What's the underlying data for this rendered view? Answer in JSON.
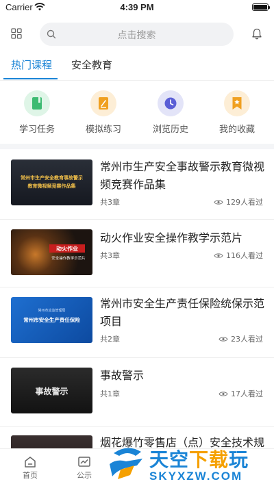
{
  "status_bar": {
    "carrier": "Carrier",
    "time": "4:39 PM"
  },
  "header": {
    "search_placeholder": "点击搜索"
  },
  "tabs": [
    {
      "label": "热门课程",
      "active": true
    },
    {
      "label": "安全教育",
      "active": false
    }
  ],
  "quick_actions": [
    {
      "label": "学习任务",
      "icon": "book-icon",
      "color": "#3dbb72",
      "bg": "#dff5e7"
    },
    {
      "label": "模拟练习",
      "icon": "exercise-icon",
      "color": "#f0a020",
      "bg": "#fdeed6"
    },
    {
      "label": "浏览历史",
      "icon": "clock-icon",
      "color": "#5b5fd6",
      "bg": "#e3e4f8"
    },
    {
      "label": "我的收藏",
      "icon": "bookmark-icon",
      "color": "#f0a020",
      "bg": "#fdeed6"
    }
  ],
  "courses": [
    {
      "title": "常州市生产安全事故警示教育微视频竞赛作品集",
      "chapters": "共3章",
      "views": "129人看过",
      "thumb_lines": [
        "常州市生产安全教育事故警示",
        "教育微视频竞赛作品集"
      ]
    },
    {
      "title": "动火作业安全操作教学示范片",
      "chapters": "共3章",
      "views": "116人看过",
      "thumb_lines": [
        "动火作业",
        "安全操作教学示范片"
      ]
    },
    {
      "title": "常州市安全生产责任保险统保示范项目",
      "chapters": "共2章",
      "views": "23人看过",
      "thumb_lines": [
        "常州市应急管理局",
        "常州市安全生产责任保险"
      ]
    },
    {
      "title": "事故警示",
      "chapters": "共1章",
      "views": "17人看过",
      "thumb_lines": [
        "事故警示"
      ]
    },
    {
      "title": "烟花爆竹零售店（点）安全技术规",
      "chapters": "",
      "views": "",
      "thumb_lines": []
    }
  ],
  "bottom_nav": [
    {
      "label": "首页",
      "icon": "home-icon"
    },
    {
      "label": "公示",
      "icon": "chart-icon"
    }
  ],
  "watermark": {
    "big_blue": "天空",
    "big_orange": "下载",
    "big_blue2": "玩",
    "small": "SKYXZW.COM"
  }
}
